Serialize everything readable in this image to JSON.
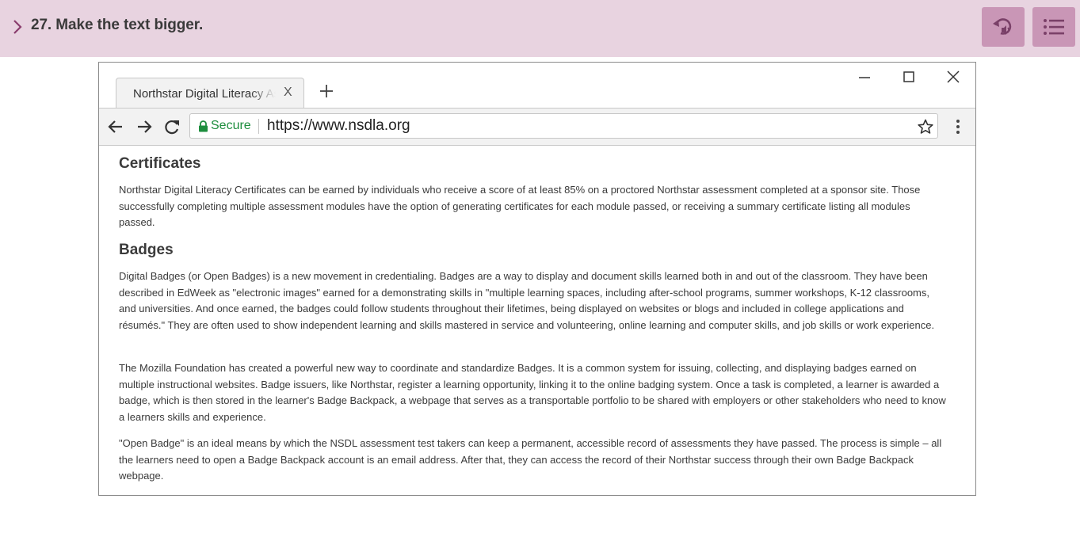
{
  "task": {
    "title": "27. Make the text bigger."
  },
  "toolbar_buttons": {
    "replay_icon": "replay-audio-icon",
    "menu_icon": "list-menu-icon"
  },
  "browser": {
    "tab": {
      "title": "Northstar Digital Literacy Assessment",
      "close": "X"
    },
    "new_tab_icon": "plus-icon",
    "window_controls": [
      "minimize-icon",
      "maximize-icon",
      "close-icon"
    ],
    "address_bar": {
      "secure_label": "Secure",
      "url": "https://www.nsdla.org"
    }
  },
  "page": {
    "certificates": {
      "heading": "Certificates",
      "text": "Northstar Digital Literacy Certificates can be earned by individuals who receive a score of at least 85% on a proctored Northstar assessment completed at a sponsor site. Those successfully completing multiple assessment modules have the option of generating certificates for each module passed, or receiving a summary certificate listing all modules passed."
    },
    "badges": {
      "heading": "Badges",
      "paragraphs": [
        "Digital Badges (or Open Badges) is a new movement in credentialing. Badges are a way to display and document skills learned both in and out of the classroom. They have been described in EdWeek as \"electronic images\" earned for a demonstrating skills in \"multiple learning spaces, including after-school programs, summer workshops, K-12 classrooms, and universities. And once earned, the badges could follow students throughout their lifetimes, being displayed on websites or blogs and included in college applications and résumés.\" They are often used to show independent learning and skills mastered in service and volunteering, online learning and computer skills, and job skills or work experience.",
        "The Mozilla Foundation has created a powerful new way to coordinate and standardize Badges. It is a common system for issuing, collecting, and displaying badges earned on multiple instructional websites. Badge issuers, like Northstar, register a learning opportunity, linking it to the online badging system. Once a task is completed, a learner is awarded a badge, which is then stored in the learner's Badge Backpack, a webpage that serves as a transportable portfolio to be shared with employers or other stakeholders who need to know a learners skills and experience.",
        "\"Open Badge\" is an ideal means by which the NSDL assessment test takers can keep a permanent, accessible record of assessments they have passed. The process is simple – all the learners need to open a Badge Backpack account is an email address. After that, they can access the record of their Northstar success through their own Badge Backpack webpage."
      ]
    }
  },
  "colors": {
    "topbar_bg": "#e8d3e0",
    "topbar_button": "#c996b6",
    "secure_green": "#1e8e3e"
  }
}
